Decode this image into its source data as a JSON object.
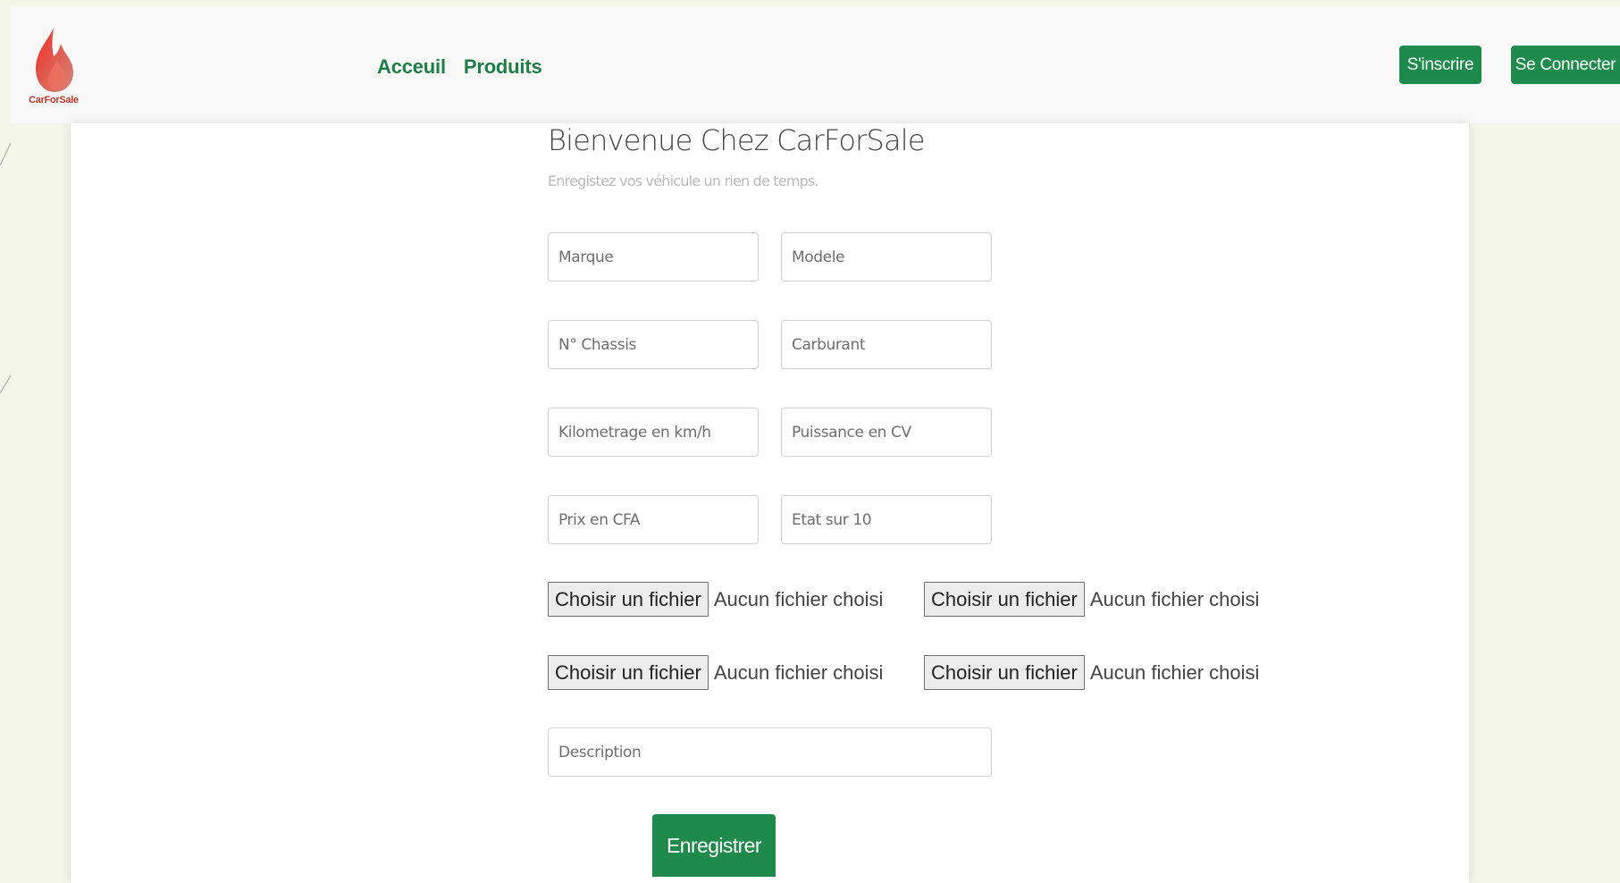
{
  "brand": {
    "logo_text": "CarForSale",
    "logo_colors": [
      "#e53935",
      "#c0392b",
      "#d97b6c"
    ]
  },
  "nav": {
    "items": [
      {
        "label": "Acceuil"
      },
      {
        "label": "Produits"
      }
    ]
  },
  "auth": {
    "register_label": "S'inscrire",
    "login_label": "Se Connecter"
  },
  "form": {
    "title": "Bienvenue Chez CarForSale",
    "subtitle": "Enregistez vos véhicule un rien de temps.",
    "fields": {
      "marque": "Marque",
      "modele": "Modele",
      "chassis": "N° Chassis",
      "carburant": "Carburant",
      "kilometrage": "Kilometrage en km/h",
      "puissance": "Puissance en CV",
      "prix": "Prix en CFA",
      "etat": "Etat sur 10",
      "description": "Description"
    },
    "files": [
      {
        "button": "Choisir un fichier",
        "status": "Aucun fichier choisi"
      },
      {
        "button": "Choisir un fichier",
        "status": "Aucun fichier choisi"
      },
      {
        "button": "Choisir un fichier",
        "status": "Aucun fichier choisi"
      },
      {
        "button": "Choisir un fichier",
        "status": "Aucun fichier choisi"
      }
    ],
    "submit_label": "Enregistrer"
  },
  "colors": {
    "accent": "#1e8a4c",
    "nav_text": "#1e7e46"
  }
}
